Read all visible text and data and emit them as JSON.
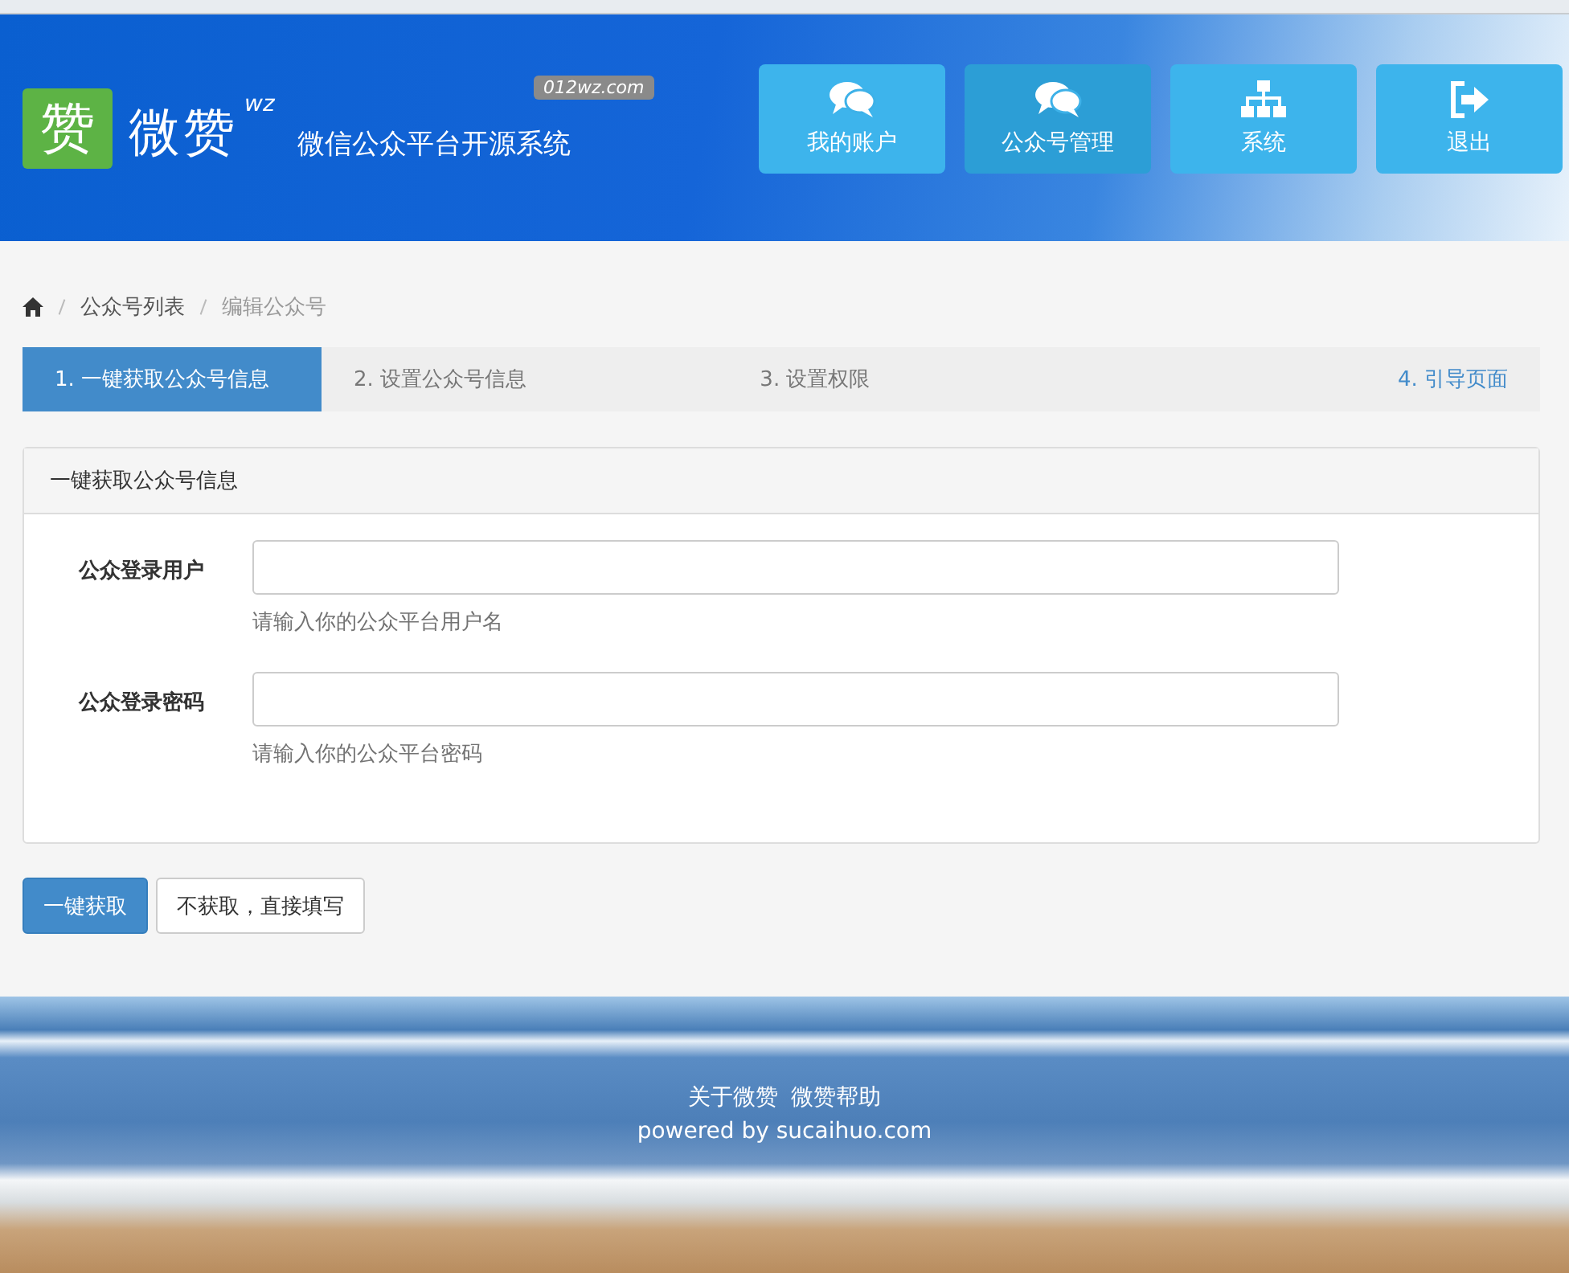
{
  "header": {
    "logo_char": "赞",
    "brand": "微赞",
    "brand_sup": "wz",
    "slogan": "微信公众平台开源系统",
    "badge": "012wz.com"
  },
  "nav": [
    {
      "label": "我的账户",
      "kind": "chat",
      "selected": false
    },
    {
      "label": "公众号管理",
      "kind": "chat",
      "selected": true
    },
    {
      "label": "系统",
      "kind": "sitemap",
      "selected": false
    },
    {
      "label": "退出",
      "kind": "logout",
      "selected": false
    }
  ],
  "breadcrumb": [
    "公众号列表",
    "编辑公众号"
  ],
  "steps": [
    {
      "label": "1. 一键获取公众号信息",
      "selected": true
    },
    {
      "label": "2. 设置公众号信息",
      "selected": false
    },
    {
      "label": "3. 设置权限",
      "selected": false
    },
    {
      "label": "4. 引导页面",
      "selected": false
    }
  ],
  "panel": {
    "title": "一键获取公众号信息",
    "fields": [
      {
        "label": "公众登录用户",
        "help": "请输入你的公众平台用户名"
      },
      {
        "label": "公众登录密码",
        "help": "请输入你的公众平台密码"
      }
    ]
  },
  "buttons": [
    {
      "label": "一键获取",
      "kind": "primary"
    },
    {
      "label": "不获取，直接填写",
      "kind": "default"
    }
  ],
  "footer": {
    "links": [
      "关于微赞",
      "微赞帮助"
    ],
    "powered": "powered by sucaihuo.com"
  }
}
